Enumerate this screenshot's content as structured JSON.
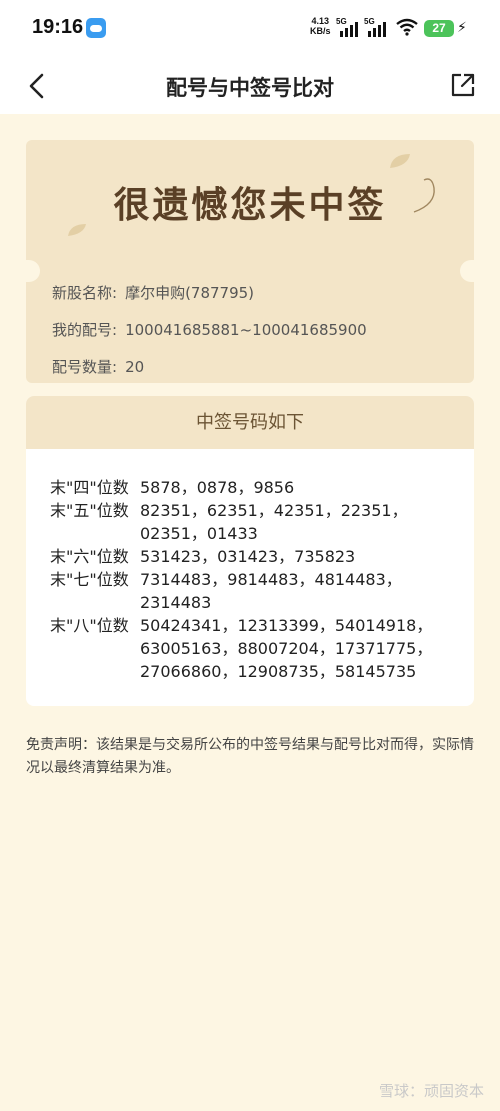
{
  "status_bar": {
    "time": "19:16",
    "net_speed_value": "4.13",
    "net_speed_unit": "KB/s",
    "sim1_label": "5G",
    "sim2_label": "5G",
    "battery": "27"
  },
  "nav": {
    "title": "配号与中签号比对"
  },
  "result": {
    "headline": "很遗憾您未中签",
    "info": [
      {
        "key": "新股名称:",
        "value": "摩尔申购(787795)"
      },
      {
        "key": "我的配号:",
        "value": "100041685881~100041685900"
      },
      {
        "key": "配号数量:",
        "value": "20"
      }
    ]
  },
  "winning": {
    "header": "中签号码如下",
    "rows": [
      {
        "label": "末\"四\"位数",
        "numbers": "5878，0878，9856"
      },
      {
        "label": "末\"五\"位数",
        "numbers": "82351，62351，42351，22351，02351，01433"
      },
      {
        "label": "末\"六\"位数",
        "numbers": "531423，031423，735823"
      },
      {
        "label": "末\"七\"位数",
        "numbers": "7314483，9814483，4814483，2314483"
      },
      {
        "label": "末\"八\"位数",
        "numbers": "50424341，12313399，54014918，63005163，88007204，17371775，27066860，12908735，58145735"
      }
    ]
  },
  "disclaimer": "免责声明：该结果是与交易所公布的中签号结果与配号比对而得，实际情况以最终清算结果为准。",
  "watermark": "雪球：顽固资本"
}
